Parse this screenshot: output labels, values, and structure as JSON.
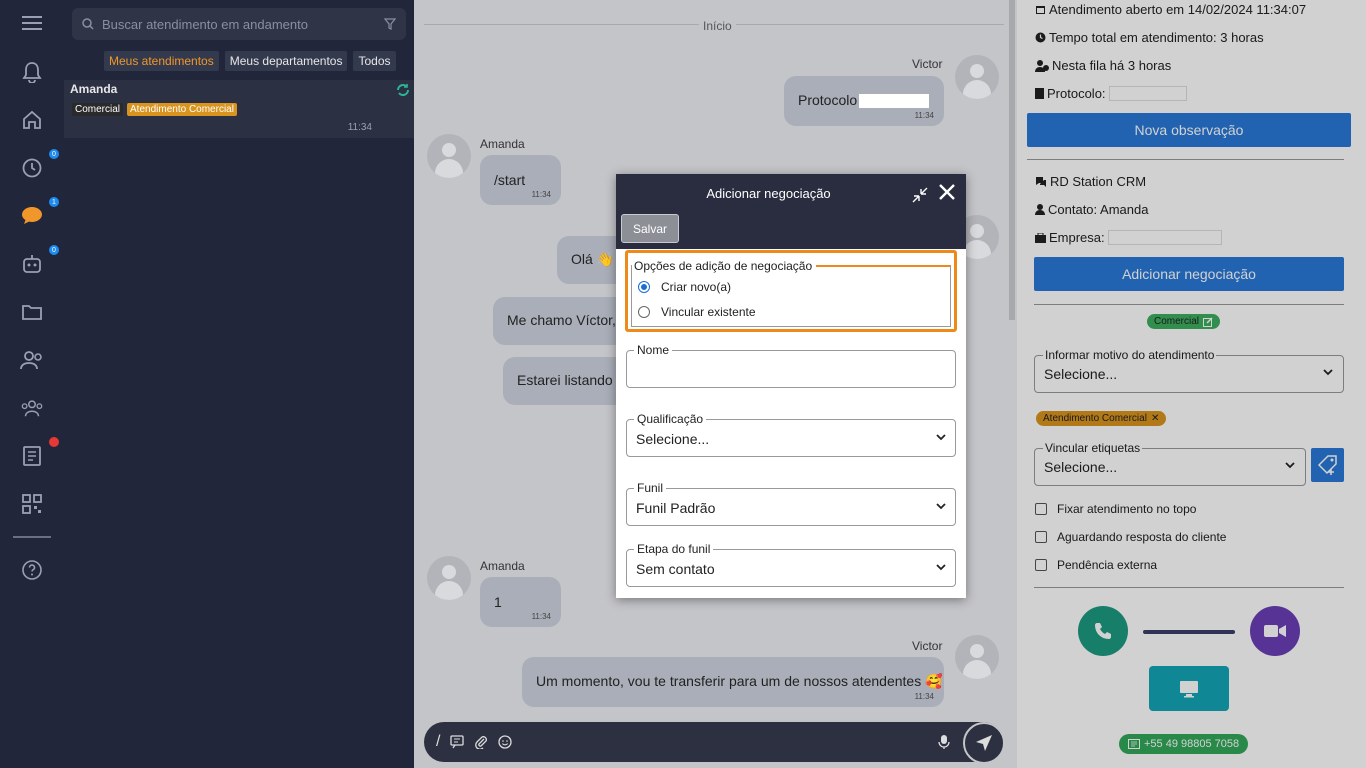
{
  "sidebar": {
    "icons": [
      "menu-icon",
      "bell-icon",
      "home-icon",
      "history-icon",
      "chat-icon",
      "bot-icon",
      "folder-icon",
      "contacts-icon",
      "groups-icon",
      "directory-icon",
      "qr-icon",
      "help-icon"
    ],
    "badges": {
      "history": "0",
      "chat": "1",
      "bot": "0"
    }
  },
  "list": {
    "search_placeholder": "Buscar atendimento em andamento",
    "filters": [
      "Meus atendimentos",
      "Meus departamentos",
      "Todos"
    ],
    "active_filter": "Meus atendimentos",
    "conversations": [
      {
        "name": "Amanda",
        "tags": [
          "Comercial",
          "Atendimento Comercial"
        ],
        "time": "11:34"
      }
    ]
  },
  "chat": {
    "date_label": "Início",
    "messages": [
      {
        "sender": "Victor",
        "text": "Protocolo",
        "time": "11:34"
      },
      {
        "sender": "Amanda",
        "text": "/start",
        "time": "11:34"
      },
      {
        "sender": "",
        "text": "Olá 👋",
        "time": ""
      },
      {
        "sender": "",
        "text": "Me chamo Víctor,",
        "time": ""
      },
      {
        "sender": "",
        "text": "Estarei listando a",
        "time": ""
      },
      {
        "sender": "Amanda",
        "text": "1",
        "time": "11:34"
      },
      {
        "sender": "Victor",
        "text": "Um momento, vou te transferir para um de nossos atendentes 🥰",
        "time": "11:34"
      }
    ]
  },
  "modal": {
    "title": "Adicionar negociação",
    "save_label": "Salvar",
    "options_legend": "Opções de adição de negociação",
    "options": [
      "Criar novo(a)",
      "Vincular existente"
    ],
    "selected_option": "Criar novo(a)",
    "fields": {
      "nome": {
        "label": "Nome",
        "value": ""
      },
      "qualificacao": {
        "label": "Qualificação",
        "value": "Selecione..."
      },
      "funil": {
        "label": "Funil",
        "value": "Funil Padrão"
      },
      "etapa": {
        "label": "Etapa do funil",
        "value": "Sem contato"
      }
    }
  },
  "details": {
    "opened": "Atendimento aberto em 14/02/2024 11:34:07",
    "total_time": "Tempo total em atendimento: 3 horas",
    "queue": "Nesta fila há 3 horas",
    "protocol_label": "Protocolo:",
    "new_note_label": "Nova observação",
    "crm_title": "RD Station CRM",
    "contact": "Contato: Amanda",
    "company_label": "Empresa:",
    "add_deal_label": "Adicionar negociação",
    "department_pill": "Comercial",
    "reason_label": "Informar motivo do atendimento",
    "reason_value": "Selecione...",
    "tag_pill": "Atendimento Comercial",
    "tags_label": "Vincular etiquetas",
    "tags_value": "Selecione...",
    "checkboxes": [
      "Fixar atendimento no topo",
      "Aguardando resposta do cliente",
      "Pendência externa"
    ],
    "phone": "+55 49 98805 7058"
  },
  "colors": {
    "accent_orange": "#ee8a1a",
    "primary_blue": "#2979d8",
    "dark": "#22263a",
    "green": "#2fa58a",
    "purple": "#6a3fb5",
    "teal": "#13a5b5"
  }
}
